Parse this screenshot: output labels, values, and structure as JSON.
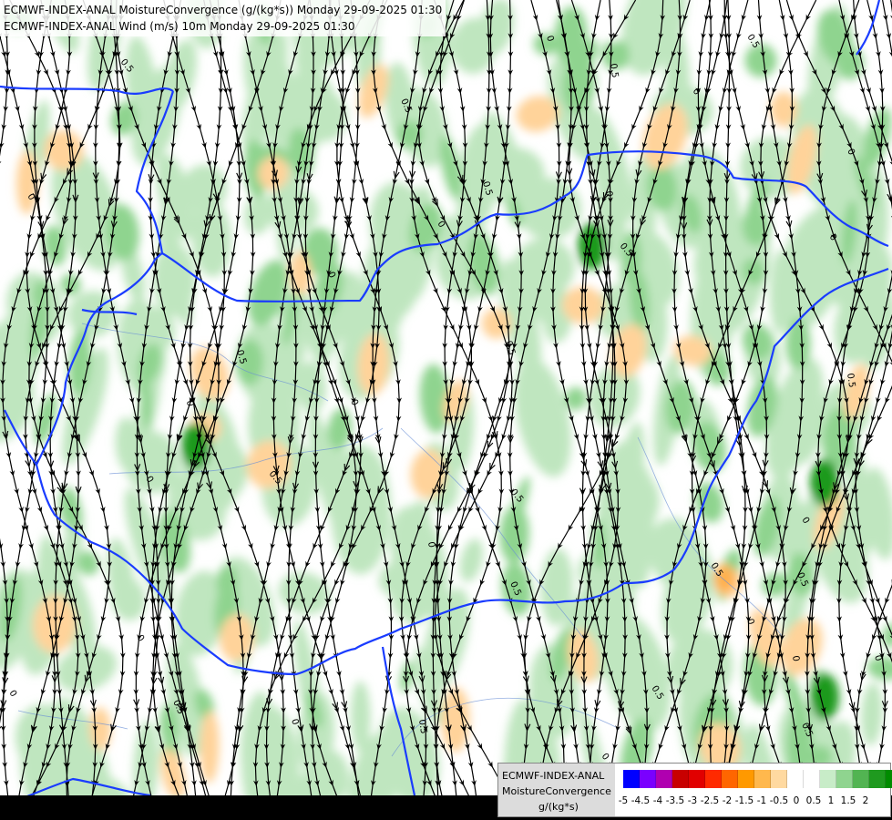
{
  "title": {
    "line1": "ECMWF-INDEX-ANAL MoistureConvergence (g/(kg*s)) Monday 29-09-2025 01:30",
    "line2": "ECMWF-INDEX-ANAL Wind (m/s) 10m Monday 29-09-2025 01:30"
  },
  "legend": {
    "model": "ECMWF-INDEX-ANAL",
    "parameter": "MoistureConvergence",
    "unit": "g/(kg*s)",
    "colors": [
      "#0000ff",
      "#7a00ff",
      "#b000b0",
      "#c80000",
      "#e10000",
      "#ff2a00",
      "#ff6600",
      "#ff9900",
      "#ffb84d",
      "#ffd9a0",
      "#ffffff",
      "#ffffff",
      "#c8ecc8",
      "#8fd48f",
      "#52b452",
      "#1f9a1f",
      "#008c00"
    ],
    "ticks": [
      "-5",
      "-4.5",
      "-4",
      "-3.5",
      "-3",
      "-2.5",
      "-2",
      "-1.5",
      "-1",
      "-0.5",
      "0",
      "0.5",
      "1",
      "1.5",
      "2"
    ]
  },
  "contour_labels": [
    "0.5",
    "0",
    "0.5",
    "0",
    "0.5",
    "0",
    "0.5",
    "0",
    "0.5",
    "0",
    "0.5",
    "0",
    "0",
    "0.5",
    "0",
    "0.5",
    "0",
    "0",
    "0.5",
    "0",
    "0.5",
    "0",
    "0.5",
    "0",
    "0",
    "0",
    "0",
    "0.5",
    "0",
    "0.5",
    "0",
    "0.5",
    "0.5",
    "0",
    "0.5",
    "0",
    "0.5",
    "0.5"
  ]
}
